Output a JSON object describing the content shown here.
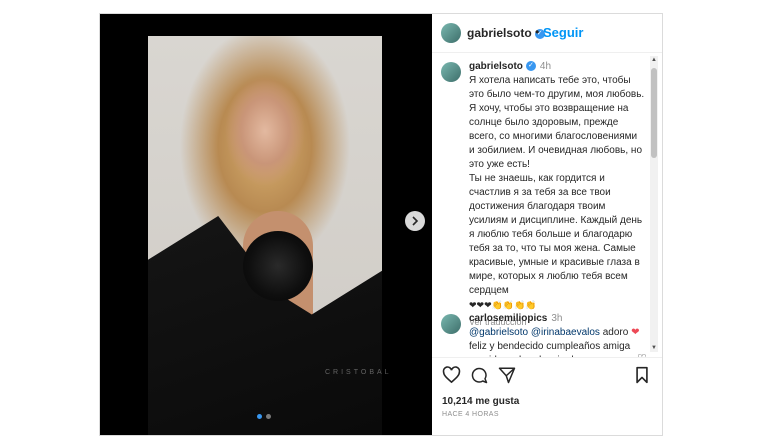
{
  "post": {
    "username": "gabrielsoto",
    "follow_label": "Seguir",
    "dot_separator": "•",
    "watermark": "CRISTOBAL"
  },
  "caption": {
    "username": "gabrielsoto",
    "time": "4h",
    "text": "Я хотела написать тебе это, чтобы это было чем-то другим, моя любовь. Я хочу, чтобы это возвращение на солнце было здоровым, прежде всего, со многими благословениями и зобилием. И очевидная любовь, но это уже есть!\nТы не знаешь, как гордится и счастлив я за тебя за все твои достижения благодаря твоим усилиям и дисциплине. Каждый день я люблю тебя больше и благодарю тебя за то, что ты моя жена. Самые красивые, умные и красивые глаза в мире, которых я люблю тебя всем сердцем",
    "emojis": "❤❤❤👏👏👏👏",
    "translate_label": "Ver traducción"
  },
  "comment": {
    "username": "carlosemiliopics",
    "time": "3h",
    "mention1": "@gabrielsoto",
    "mention2": "@irinabaevalos",
    "text_part1": " adoro ",
    "text_part2": " feliz y bendecido cumpleaños amiga querida....abundancia de"
  },
  "footer": {
    "likes": "10,214 me gusta",
    "ago": "HACE 4 HORAS"
  },
  "colors": {
    "accent": "#0095f6",
    "heart": "#ed4956",
    "muted": "#8e8e8e"
  },
  "icons": [
    "verified-icon",
    "chevron-right-icon",
    "heart-icon",
    "comment-icon",
    "share-icon",
    "bookmark-icon"
  ],
  "carousel": {
    "total": 2,
    "current": 1
  }
}
